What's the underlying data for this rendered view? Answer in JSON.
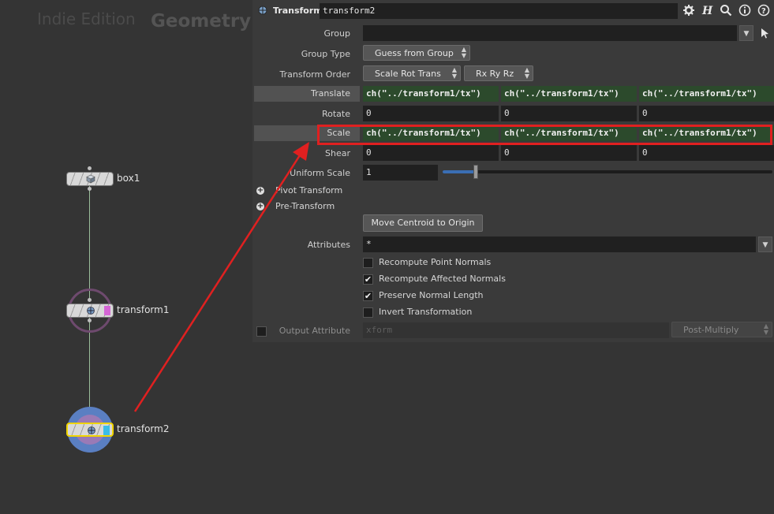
{
  "network": {
    "watermark": "Indie Edition",
    "context": "Geometry",
    "nodes": [
      {
        "name": "box1"
      },
      {
        "name": "transform1"
      },
      {
        "name": "transform2"
      }
    ]
  },
  "parm_header": {
    "node_type": "Transform",
    "node_name": "transform2"
  },
  "parms": {
    "group_label": "Group",
    "group_value": "",
    "group_type_label": "Group Type",
    "group_type_value": "Guess from Group",
    "xform_order_label": "Transform Order",
    "xform_order_value": "Scale Rot Trans",
    "rot_order_value": "Rx Ry Rz",
    "translate_label": "Translate",
    "translate": [
      "ch(\"../transform1/tx\")",
      "ch(\"../transform1/tx\")",
      "ch(\"../transform1/tx\")"
    ],
    "rotate_label": "Rotate",
    "rotate": [
      "0",
      "0",
      "0"
    ],
    "scale_label": "Scale",
    "scale": [
      "ch(\"../transform1/tx\")",
      "ch(\"../transform1/tx\")",
      "ch(\"../transform1/tx\")"
    ],
    "shear_label": "Shear",
    "shear": [
      "0",
      "0",
      "0"
    ],
    "uniform_scale_label": "Uniform Scale",
    "uniform_scale_value": "1",
    "uniform_scale_fraction": 0.1,
    "pivot_folder": "Pivot Transform",
    "pre_folder": "Pre-Transform",
    "centroid_button": "Move Centroid to Origin",
    "attributes_label": "Attributes",
    "attributes_value": "*",
    "checks": [
      {
        "label": "Recompute Point Normals",
        "checked": false
      },
      {
        "label": "Recompute Affected Normals",
        "checked": true
      },
      {
        "label": "Preserve Normal Length",
        "checked": true
      },
      {
        "label": "Invert Transformation",
        "checked": false
      }
    ],
    "output_attr_label": "Output Attribute",
    "output_attr_placeholder": "xform",
    "multiply_value": "Post-Multiply"
  },
  "colors": {
    "expression_bg": "#2c4a2c",
    "annotation": "#e02020",
    "template_flag": "#d565d5",
    "display_flag": "#3bbde8"
  }
}
